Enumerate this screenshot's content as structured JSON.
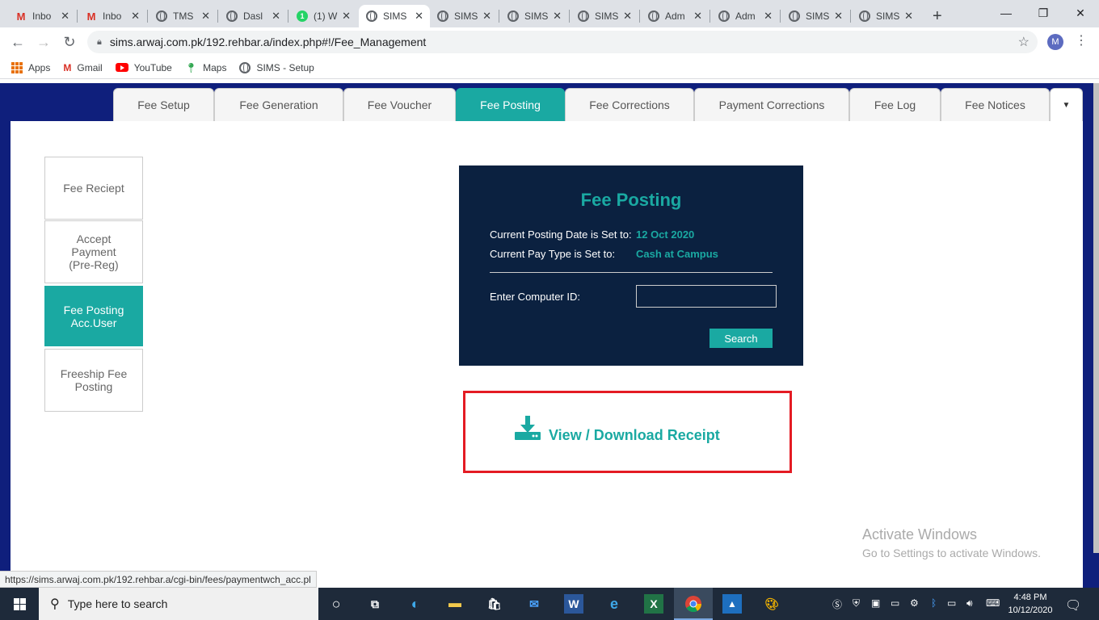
{
  "browser": {
    "tabs": [
      {
        "title": "Inbo",
        "icon": "gmail-icon"
      },
      {
        "title": "Inbo",
        "icon": "gmail-icon"
      },
      {
        "title": "TMS",
        "icon": "globe-icon"
      },
      {
        "title": "Dasl",
        "icon": "globe-icon"
      },
      {
        "title": "(1) W",
        "icon": "whatsapp-icon",
        "badge": "1"
      },
      {
        "title": "SIMS",
        "icon": "globe-icon",
        "active": true
      },
      {
        "title": "SIMS",
        "icon": "globe-icon"
      },
      {
        "title": "SIMS",
        "icon": "globe-icon"
      },
      {
        "title": "SIMS",
        "icon": "globe-icon"
      },
      {
        "title": "Adm",
        "icon": "globe-icon"
      },
      {
        "title": "Adm",
        "icon": "globe-icon"
      },
      {
        "title": "SIMS",
        "icon": "globe-icon"
      },
      {
        "title": "SIMS",
        "icon": "globe-icon"
      }
    ],
    "url": "sims.arwaj.com.pk/192.rehbar.a/index.php#!/Fee_Management",
    "profile_initial": "M",
    "bookmarks": [
      "Apps",
      "Gmail",
      "YouTube",
      "Maps",
      "SIMS - Setup"
    ]
  },
  "module_tabs": [
    "Fee Setup",
    "Fee Generation",
    "Fee Voucher",
    "Fee Posting",
    "Fee Corrections",
    "Payment Corrections",
    "Fee Log",
    "Fee Notices"
  ],
  "active_module_tab": "Fee Posting",
  "sidebar": [
    {
      "label": "Fee Reciept"
    },
    {
      "label": "Accept Payment (Pre-Reg)"
    },
    {
      "label": "Fee Posting Acc.User",
      "active": true
    },
    {
      "label": "Freeship Fee Posting"
    }
  ],
  "panel": {
    "title": "Fee Posting",
    "posting_date_label": "Current Posting Date is Set to:",
    "posting_date_value": "12 Oct 2020",
    "pay_type_label": "Current Pay Type is Set to:",
    "pay_type_value": "Cash at Campus",
    "computer_id_label": "Enter Computer ID:",
    "computer_id_value": "",
    "search_label": "Search"
  },
  "download": {
    "label": "View / Download Receipt"
  },
  "watermark": {
    "line1": "Activate Windows",
    "line2": "Go to Settings to activate Windows."
  },
  "status_url": "https://sims.arwaj.com.pk/192.rehbar.a/cgi-bin/fees/paymentwch_acc.pl",
  "taskbar": {
    "search_placeholder": "Type here to search",
    "time": "4:48 PM",
    "date": "10/12/2020"
  },
  "colors": {
    "accent": "#1aa9a2",
    "navy": "#0b2140",
    "page_bg": "#0f1f7c",
    "highlight": "#e41b23"
  }
}
